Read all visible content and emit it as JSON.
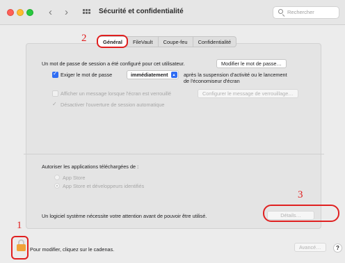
{
  "window": {
    "title": "Sécurité et confidentialité",
    "search_placeholder": "Rechercher"
  },
  "icons": [
    "close-icon",
    "minimize-icon",
    "zoom-icon",
    "chevron-left-icon",
    "chevron-right-icon",
    "grid-icon",
    "search-icon",
    "lock-icon",
    "help-icon"
  ],
  "tabs": [
    {
      "label": "Général",
      "active": true
    },
    {
      "label": "FileVault",
      "active": false
    },
    {
      "label": "Coupe-feu",
      "active": false
    },
    {
      "label": "Confidentialité",
      "active": false
    }
  ],
  "general": {
    "password_text": "Un mot de passe de session a été configuré pour cet utilisateur.",
    "change_password_button": "Modifier le mot de passe…",
    "require_password_label": "Exiger le mot de passe",
    "require_password_value": "immédiatement",
    "require_password_after_1": "après la suspension d'activité ou le lancement",
    "require_password_after_2": "de l'économiseur d'écran",
    "show_message_label": "Afficher un message lorsque l'écran est verrouillé",
    "configure_message_button": "Configurer le message de verrouillage…",
    "disable_autologin_label": "Désactiver l'ouverture de session automatique"
  },
  "downloads": {
    "label": "Autoriser les applications téléchargées de :",
    "options": [
      {
        "label": "App Store",
        "selected": false
      },
      {
        "label": "App Store et développeurs identifiés",
        "selected": true
      }
    ]
  },
  "system_software": {
    "text": "Un logiciel système nécessite votre attention avant de pouvoir être utilisé.",
    "details_button": "Détails…"
  },
  "footer": {
    "lock_text": "Pour modifier, cliquez sur le cadenas.",
    "advanced_button": "Avancé…",
    "help_button": "?"
  },
  "annotations": [
    {
      "number": "1"
    },
    {
      "number": "2"
    },
    {
      "number": "3"
    }
  ],
  "colors": {
    "accent": "#2f6df3",
    "annotation": "#e02020",
    "lock": "#f0a43a"
  }
}
